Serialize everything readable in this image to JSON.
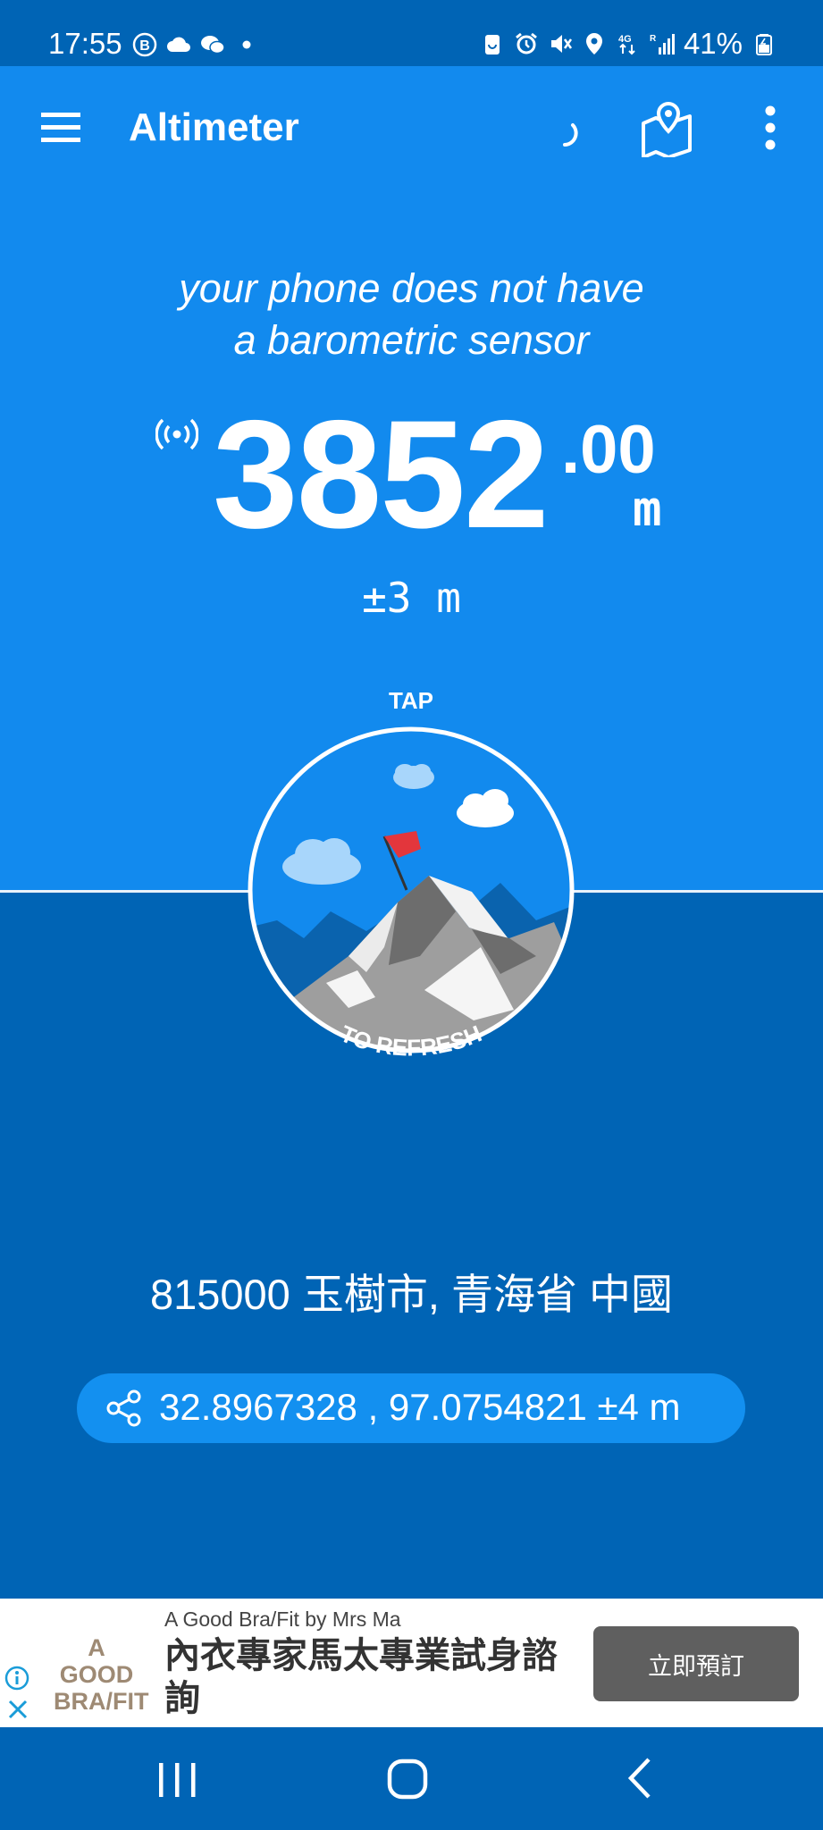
{
  "status_bar": {
    "time": "17:55",
    "battery": "41%",
    "left_icons": [
      "b-badge-icon",
      "cloud-icon",
      "wechat-icon",
      "dot-icon"
    ],
    "right_icons": [
      "battery-saver-icon",
      "alarm-icon",
      "mute-icon",
      "location-icon",
      "data-4g-icon",
      "signal-icon",
      "battery-icon"
    ]
  },
  "toolbar": {
    "title": "Altimeter",
    "menu_icon": "hamburger-menu-icon",
    "loading_icon": "spinner-icon",
    "map_icon": "map-pin-icon",
    "more_icon": "more-vert-icon"
  },
  "main": {
    "sensor_message_line1": "your phone does not have",
    "sensor_message_line2": "a barometric sensor",
    "altitude_integer": "3852",
    "altitude_decimal": ".00",
    "altitude_unit": "m",
    "accuracy": "±3 m",
    "refresh_top_label": "TAP",
    "refresh_bottom_label": "TO REFRESH",
    "location": "815000 玉樹市, 青海省 中國",
    "coordinates": "32.8967328 , 97.0754821 ±4 m"
  },
  "ad": {
    "logo_line1": "A GOOD",
    "logo_line2": "BRA/FIT",
    "advertiser": "A Good Bra/Fit by Mrs Ma",
    "headline": "內衣專家馬太專業試身諮詢",
    "cta": "立即預訂"
  },
  "colors": {
    "primary": "#128aee",
    "primary_dark": "#0064b5",
    "pill": "#1390f0",
    "flag": "#e3363c"
  }
}
